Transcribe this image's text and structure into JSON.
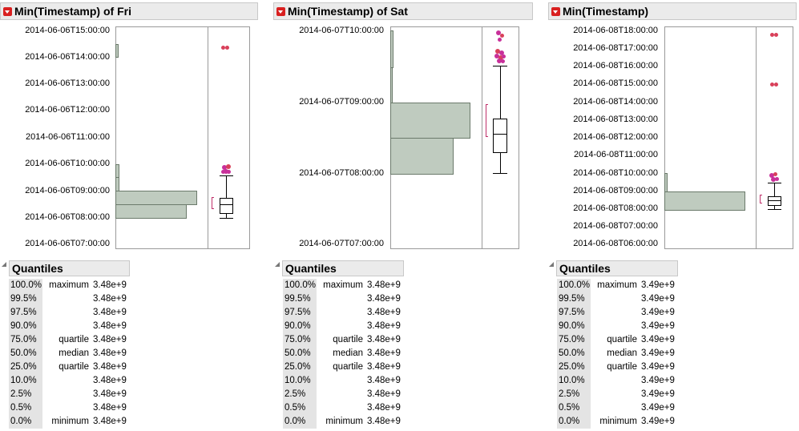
{
  "panels": [
    {
      "title": "Min(Timestamp) of Fri",
      "y_labels": [
        "2014-06-06T15:00:00",
        "2014-06-06T14:00:00",
        "2014-06-06T13:00:00",
        "2014-06-06T12:00:00",
        "2014-06-06T11:00:00",
        "2014-06-06T10:00:00",
        "2014-06-06T09:00:00",
        "2014-06-06T08:00:00",
        "2014-06-06T07:00:00"
      ],
      "quantiles_title": "Quantiles",
      "quantiles": [
        {
          "pct": "100.0%",
          "label": "maximum",
          "value": "3.48e+9"
        },
        {
          "pct": "99.5%",
          "label": "",
          "value": "3.48e+9"
        },
        {
          "pct": "97.5%",
          "label": "",
          "value": "3.48e+9"
        },
        {
          "pct": "90.0%",
          "label": "",
          "value": "3.48e+9"
        },
        {
          "pct": "75.0%",
          "label": "quartile",
          "value": "3.48e+9"
        },
        {
          "pct": "50.0%",
          "label": "median",
          "value": "3.48e+9"
        },
        {
          "pct": "25.0%",
          "label": "quartile",
          "value": "3.48e+9"
        },
        {
          "pct": "10.0%",
          "label": "",
          "value": "3.48e+9"
        },
        {
          "pct": "2.5%",
          "label": "",
          "value": "3.48e+9"
        },
        {
          "pct": "0.5%",
          "label": "",
          "value": "3.48e+9"
        },
        {
          "pct": "0.0%",
          "label": "minimum",
          "value": "3.48e+9"
        }
      ]
    },
    {
      "title": "Min(Timestamp) of Sat",
      "y_labels": [
        "2014-06-07T10:00:00",
        "2014-06-07T09:00:00",
        "2014-06-07T08:00:00",
        "2014-06-07T07:00:00"
      ],
      "quantiles_title": "Quantiles",
      "quantiles": [
        {
          "pct": "100.0%",
          "label": "maximum",
          "value": "3.48e+9"
        },
        {
          "pct": "99.5%",
          "label": "",
          "value": "3.48e+9"
        },
        {
          "pct": "97.5%",
          "label": "",
          "value": "3.48e+9"
        },
        {
          "pct": "90.0%",
          "label": "",
          "value": "3.48e+9"
        },
        {
          "pct": "75.0%",
          "label": "quartile",
          "value": "3.48e+9"
        },
        {
          "pct": "50.0%",
          "label": "median",
          "value": "3.48e+9"
        },
        {
          "pct": "25.0%",
          "label": "quartile",
          "value": "3.48e+9"
        },
        {
          "pct": "10.0%",
          "label": "",
          "value": "3.48e+9"
        },
        {
          "pct": "2.5%",
          "label": "",
          "value": "3.48e+9"
        },
        {
          "pct": "0.5%",
          "label": "",
          "value": "3.48e+9"
        },
        {
          "pct": "0.0%",
          "label": "minimum",
          "value": "3.48e+9"
        }
      ]
    },
    {
      "title": "Min(Timestamp)",
      "y_labels": [
        "2014-06-08T18:00:00",
        "2014-06-08T17:00:00",
        "2014-06-08T16:00:00",
        "2014-06-08T15:00:00",
        "2014-06-08T14:00:00",
        "2014-06-08T13:00:00",
        "2014-06-08T12:00:00",
        "2014-06-08T11:00:00",
        "2014-06-08T10:00:00",
        "2014-06-08T09:00:00",
        "2014-06-08T08:00:00",
        "2014-06-08T07:00:00",
        "2014-06-08T06:00:00"
      ],
      "quantiles_title": "Quantiles",
      "quantiles": [
        {
          "pct": "100.0%",
          "label": "maximum",
          "value": "3.49e+9"
        },
        {
          "pct": "99.5%",
          "label": "",
          "value": "3.49e+9"
        },
        {
          "pct": "97.5%",
          "label": "",
          "value": "3.49e+9"
        },
        {
          "pct": "90.0%",
          "label": "",
          "value": "3.49e+9"
        },
        {
          "pct": "75.0%",
          "label": "quartile",
          "value": "3.49e+9"
        },
        {
          "pct": "50.0%",
          "label": "median",
          "value": "3.49e+9"
        },
        {
          "pct": "25.0%",
          "label": "quartile",
          "value": "3.49e+9"
        },
        {
          "pct": "10.0%",
          "label": "",
          "value": "3.49e+9"
        },
        {
          "pct": "2.5%",
          "label": "",
          "value": "3.49e+9"
        },
        {
          "pct": "0.5%",
          "label": "",
          "value": "3.49e+9"
        },
        {
          "pct": "0.0%",
          "label": "minimum",
          "value": "3.49e+9"
        }
      ]
    }
  ],
  "colors": {
    "histogram_fill": "#bfcbbf",
    "outlier_red": "#d9405a",
    "outlier_magenta": "#c8309a",
    "bracket": "#c0306a"
  }
}
